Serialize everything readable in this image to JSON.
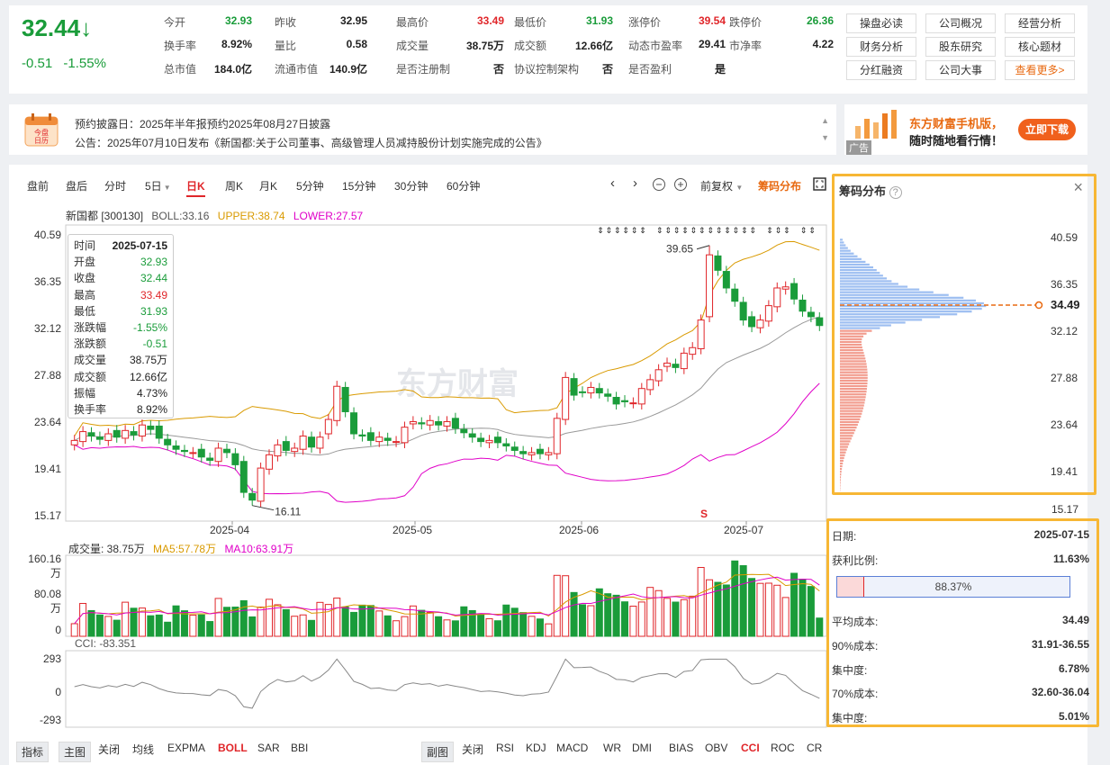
{
  "quote": {
    "price": "32.44",
    "arrow": "↓",
    "change": "-0.51",
    "change_pct": "-1.55%",
    "rows": [
      [
        {
          "label": "今开",
          "value": "32.93",
          "c": "g"
        },
        {
          "label": "昨收",
          "value": "32.95",
          "c": "k"
        },
        {
          "label": "最高价",
          "value": "33.49",
          "c": "r"
        },
        {
          "label": "最低价",
          "value": "31.93",
          "c": "g"
        },
        {
          "label": "涨停价",
          "value": "39.54",
          "c": "r"
        },
        {
          "label": "跌停价",
          "value": "26.36",
          "c": "g"
        }
      ],
      [
        {
          "label": "换手率",
          "value": "8.92%",
          "c": "k"
        },
        {
          "label": "量比",
          "value": "0.58",
          "c": "k"
        },
        {
          "label": "成交量",
          "value": "38.75万",
          "c": "k"
        },
        {
          "label": "成交额",
          "value": "12.66亿",
          "c": "k"
        },
        {
          "label": "动态市盈率",
          "value": "29.41",
          "c": "k"
        },
        {
          "label": "市净率",
          "value": "4.22",
          "c": "k"
        }
      ],
      [
        {
          "label": "总市值",
          "value": "184.0亿",
          "c": "k"
        },
        {
          "label": "流通市值",
          "value": "140.9亿",
          "c": "k"
        },
        {
          "label": "是否注册制",
          "value": "否",
          "c": "k"
        },
        {
          "label": "协议控制架构",
          "value": "否",
          "c": "k"
        },
        {
          "label": "是否盈利",
          "value": "是",
          "c": "k"
        }
      ]
    ],
    "buttons": [
      "操盘必读",
      "公司概况",
      "经营分析",
      "财务分析",
      "股东研究",
      "核心题材",
      "分红融资",
      "公司大事",
      "查看更多>"
    ]
  },
  "notice": {
    "icon_text": "今盘\n日历",
    "line1": "预约披露日：2025年半年报预约2025年08月27日披露",
    "line2": "公告：2025年07月10日发布《新国都:关于公司董事、高级管理人员减持股份计划实施完成的公告》"
  },
  "ad": {
    "title": "东方财富手机版，",
    "subtitle": "随时随地看行情！",
    "button": "立即下载",
    "tag": "广告"
  },
  "toolbar": {
    "tabs": [
      "盘前",
      "盘后",
      "分时",
      "5日",
      "日K",
      "周K",
      "月K",
      "5分钟",
      "15分钟",
      "30分钟",
      "60分钟"
    ],
    "active": "日K",
    "fuquan": "前复权",
    "chip_btn": "筹码分布"
  },
  "legend": {
    "name": "新国都 [300130]",
    "boll": "BOLL:33.16",
    "upper": "UPPER:38.74",
    "lower": "LOWER:27.57"
  },
  "price_axis": [
    "40.59",
    "36.35",
    "32.12",
    "27.88",
    "23.64",
    "19.41",
    "15.17"
  ],
  "date_axis": [
    "2025-04",
    "2025-05",
    "2025-06",
    "2025-07"
  ],
  "annotations": {
    "high": "39.65",
    "low": "16.11",
    "watermark": "东方财富",
    "flag": "S"
  },
  "tooltip": [
    {
      "label": "时间",
      "value": "2025-07-15",
      "c": "k"
    },
    {
      "label": "开盘",
      "value": "32.93",
      "c": "g"
    },
    {
      "label": "收盘",
      "value": "32.44",
      "c": "g"
    },
    {
      "label": "最高",
      "value": "33.49",
      "c": "r"
    },
    {
      "label": "最低",
      "value": "31.93",
      "c": "g"
    },
    {
      "label": "涨跌幅",
      "value": "-1.55%",
      "c": "g"
    },
    {
      "label": "涨跌额",
      "value": "-0.51",
      "c": "g"
    },
    {
      "label": "成交量",
      "value": "38.75万",
      "c": "k"
    },
    {
      "label": "成交额",
      "value": "12.66亿",
      "c": "k"
    },
    {
      "label": "振幅",
      "value": "4.73%",
      "c": "k"
    },
    {
      "label": "换手率",
      "value": "8.92%",
      "c": "k"
    }
  ],
  "volume": {
    "label": "成交量: 38.75万",
    "ma5": "MA5:57.78万",
    "ma10": "MA10:63.91万",
    "axis": [
      "160.16万",
      "80.08万",
      "0"
    ]
  },
  "cci": {
    "label": "CCI: -83.351",
    "axis": [
      "293",
      "0",
      "-293"
    ]
  },
  "chip": {
    "title": "筹码分布",
    "cost_label": "34.49",
    "axis": [
      "40.59",
      "36.35",
      "32.12",
      "27.88",
      "23.64",
      "19.41",
      "15.17"
    ],
    "date_label": "日期:",
    "date": "2025-07-15",
    "profit_label": "获利比例:",
    "profit": "11.63%",
    "bar_text": "88.37%",
    "avg_label": "平均成本:",
    "avg": "34.49",
    "c90_label": "90%成本:",
    "c90": "31.91-36.55",
    "conc1_label": "集中度:",
    "conc1": "6.78%",
    "c70_label": "70%成本:",
    "c70": "32.60-36.04",
    "conc2_label": "集中度:",
    "conc2": "5.01%",
    "profit_ratio": 0.1163
  },
  "bottom": {
    "left": [
      "指标",
      "主图",
      "关闭",
      "均线",
      "EXPMA",
      "BOLL",
      "SAR",
      "BBI"
    ],
    "right": [
      "副图",
      "关闭",
      "RSI",
      "KDJ",
      "MACD",
      "WR",
      "DMI",
      "BIAS",
      "OBV",
      "CCI",
      "ROC",
      "CR"
    ]
  },
  "colors": {
    "up": "#e0262a",
    "down": "#1a9c3a",
    "accent": "#e86a12",
    "highlight": "#f7b734"
  }
}
